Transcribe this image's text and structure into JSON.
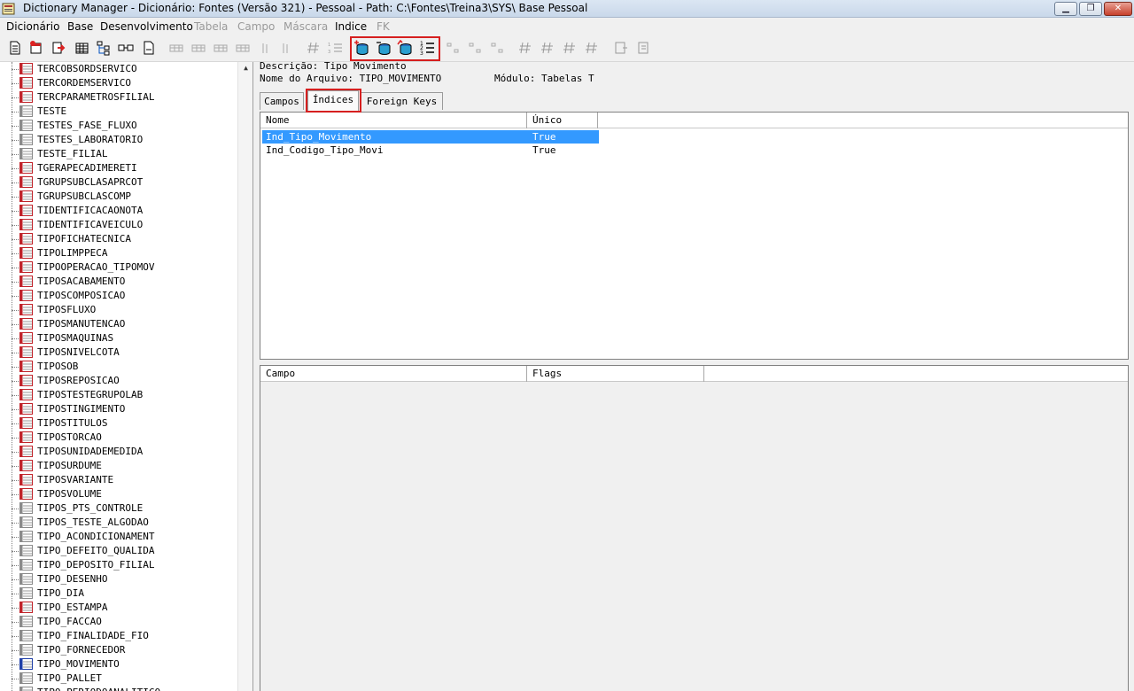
{
  "window": {
    "title": "Dictionary Manager - Dicionário: Fontes (Versão 321) - Pessoal  - Path: C:\\Fontes\\Treina3\\SYS\\ Base Pessoal"
  },
  "menu": [
    {
      "label": "Dicionário",
      "enabled": true
    },
    {
      "label": "Base",
      "enabled": true
    },
    {
      "label": "Desenvolvimento",
      "enabled": true
    },
    {
      "label": "Tabela",
      "enabled": false
    },
    {
      "label": "Campo",
      "enabled": false
    },
    {
      "label": "Máscara",
      "enabled": false
    },
    {
      "label": "Indice",
      "enabled": true
    },
    {
      "label": "FK",
      "enabled": false
    }
  ],
  "toolbar": {
    "highlight_color": "#d61f1f",
    "buttons": [
      {
        "icon": "new-document-icon"
      },
      {
        "icon": "new-table-icon"
      },
      {
        "icon": "import-arrow-icon"
      },
      {
        "icon": "table-grid-icon"
      },
      {
        "icon": "tree-structure-icon"
      },
      {
        "icon": "link-icon"
      },
      {
        "icon": "report-icon"
      },
      {
        "icon": "grid-disabled-icon"
      },
      {
        "icon": "grid-disabled-icon"
      },
      {
        "icon": "grid-disabled-icon"
      },
      {
        "icon": "grid-disabled-icon"
      },
      {
        "icon": "column-disabled-icon"
      },
      {
        "icon": "column-disabled-icon"
      },
      {
        "icon": "hash-disabled-icon"
      },
      {
        "icon": "numbered-list-disabled-icon"
      },
      {
        "icon": "add-index-icon"
      },
      {
        "icon": "remove-index-icon"
      },
      {
        "icon": "edit-index-icon"
      },
      {
        "icon": "index-order-icon"
      },
      {
        "icon": "fk-disabled-icon"
      },
      {
        "icon": "fk-disabled-icon"
      },
      {
        "icon": "fk-disabled-icon"
      },
      {
        "icon": "hash-disabled-icon"
      },
      {
        "icon": "hash-disabled-icon"
      },
      {
        "icon": "hash-disabled-icon"
      },
      {
        "icon": "hash-disabled-icon"
      },
      {
        "icon": "export-disabled-icon"
      },
      {
        "icon": "export-disabled-icon"
      }
    ]
  },
  "tree": {
    "selected": "TIPO_MOVIMENTO",
    "items": [
      {
        "label": "TERCOBSORDSERVICO",
        "kind": "red"
      },
      {
        "label": "TERCORDEMSERVICO",
        "kind": "red"
      },
      {
        "label": "TERCPARAMETROSFILIAL",
        "kind": "red"
      },
      {
        "label": "TESTE",
        "kind": "gray"
      },
      {
        "label": "TESTES_FASE_FLUXO",
        "kind": "gray"
      },
      {
        "label": "TESTES_LABORATORIO",
        "kind": "gray"
      },
      {
        "label": "TESTE_FILIAL",
        "kind": "gray"
      },
      {
        "label": "TGERAPECADIMERETI",
        "kind": "red"
      },
      {
        "label": "TGRUPSUBCLASAPRCOT",
        "kind": "red"
      },
      {
        "label": "TGRUPSUBCLASCOMP",
        "kind": "red"
      },
      {
        "label": "TIDENTIFICACAONOTA",
        "kind": "red"
      },
      {
        "label": "TIDENTIFICAVEICULO",
        "kind": "red"
      },
      {
        "label": "TIPOFICHATECNICA",
        "kind": "red"
      },
      {
        "label": "TIPOLIMPPECA",
        "kind": "red"
      },
      {
        "label": "TIPOOPERACAO_TIPOMOV",
        "kind": "red"
      },
      {
        "label": "TIPOSACABAMENTO",
        "kind": "red"
      },
      {
        "label": "TIPOSCOMPOSICAO",
        "kind": "red"
      },
      {
        "label": "TIPOSFLUXO",
        "kind": "red"
      },
      {
        "label": "TIPOSMANUTENCAO",
        "kind": "red"
      },
      {
        "label": "TIPOSMAQUINAS",
        "kind": "red"
      },
      {
        "label": "TIPOSNIVELCOTA",
        "kind": "red"
      },
      {
        "label": "TIPOSOB",
        "kind": "red"
      },
      {
        "label": "TIPOSREPOSICAO",
        "kind": "red"
      },
      {
        "label": "TIPOSTESTEGRUPOLAB",
        "kind": "red"
      },
      {
        "label": "TIPOSTINGIMENTO",
        "kind": "red"
      },
      {
        "label": "TIPOSTITULOS",
        "kind": "red"
      },
      {
        "label": "TIPOSTORCAO",
        "kind": "red"
      },
      {
        "label": "TIPOSUNIDADEMEDIDA",
        "kind": "red"
      },
      {
        "label": "TIPOSURDUME",
        "kind": "red"
      },
      {
        "label": "TIPOSVARIANTE",
        "kind": "red"
      },
      {
        "label": "TIPOSVOLUME",
        "kind": "red"
      },
      {
        "label": "TIPOS_PTS_CONTROLE",
        "kind": "gray"
      },
      {
        "label": "TIPOS_TESTE_ALGODAO",
        "kind": "gray"
      },
      {
        "label": "TIPO_ACONDICIONAMENT",
        "kind": "gray"
      },
      {
        "label": "TIPO_DEFEITO_QUALIDA",
        "kind": "gray"
      },
      {
        "label": "TIPO_DEPOSITO_FILIAL",
        "kind": "gray"
      },
      {
        "label": "TIPO_DESENHO",
        "kind": "gray"
      },
      {
        "label": "TIPO_DIA",
        "kind": "gray"
      },
      {
        "label": "TIPO_ESTAMPA",
        "kind": "red"
      },
      {
        "label": "TIPO_FACCAO",
        "kind": "gray"
      },
      {
        "label": "TIPO_FINALIDADE_FIO",
        "kind": "gray"
      },
      {
        "label": "TIPO_FORNECEDOR",
        "kind": "gray"
      },
      {
        "label": "TIPO_MOVIMENTO",
        "kind": "blue"
      },
      {
        "label": "TIPO_PALLET",
        "kind": "gray"
      },
      {
        "label": "TIPO_PERIODOANALITICO",
        "kind": "gray"
      }
    ]
  },
  "details": {
    "description_line": "Descrição: Tipo Movimento",
    "file_name_line": "Nome do Arquivo: TIPO_MOVIMENTO",
    "module_line": "Módulo: Tabelas T"
  },
  "tabs": [
    {
      "label": "Campos",
      "active": false
    },
    {
      "label": "Índices",
      "active": true
    },
    {
      "label": "Foreign Keys",
      "active": false
    }
  ],
  "indices": {
    "columns": [
      "Nome",
      "Único"
    ],
    "rows": [
      {
        "name": "Ind_Tipo_Movimento",
        "unique": "True",
        "selected": true
      },
      {
        "name": "Ind_Codigo_Tipo_Movi",
        "unique": "True",
        "selected": false
      }
    ]
  },
  "index_fields": {
    "columns": [
      "Campo",
      "Flags"
    ],
    "rows": []
  },
  "colors": {
    "selection": "#3399ff",
    "highlight_box": "#d61f1f"
  }
}
